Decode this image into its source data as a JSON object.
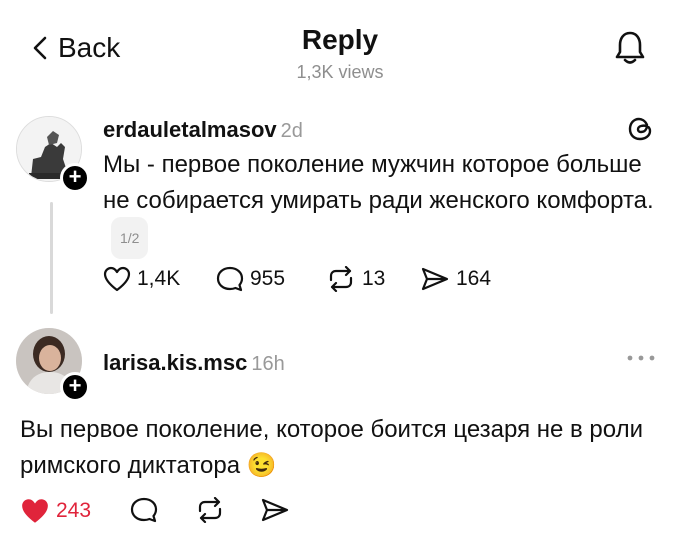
{
  "header": {
    "back_label": "Back",
    "title": "Reply",
    "views": "1,3K views"
  },
  "post": {
    "username": "erdauletalmasov",
    "time": "2d",
    "text": "Мы - первое поколение мужчин которое больше не собирается умирать ради женского комфорта.",
    "pager": "1/2",
    "likes": "1,4K",
    "comments": "955",
    "reposts": "13",
    "shares": "164"
  },
  "reply": {
    "username": "larisa.kis.msc",
    "time": "16h",
    "text": "Вы первое поколение, которое боится цезаря не в роли римского диктатора",
    "emoji": "😉",
    "likes": "243"
  },
  "colors": {
    "like_red": "#e0243b",
    "muted": "#8e8e8e"
  }
}
